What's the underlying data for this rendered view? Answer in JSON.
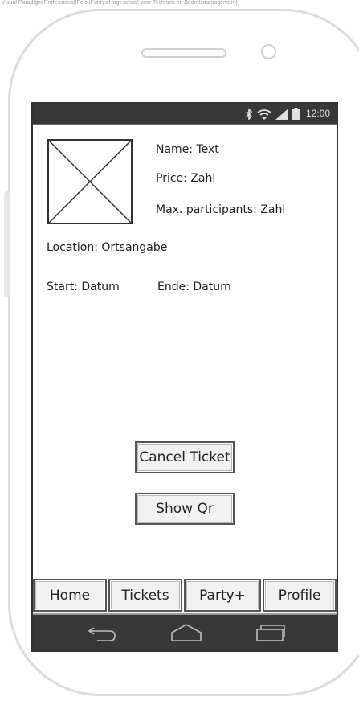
{
  "watermark": "Visual Paradigm Professional(Felix(Fontys Hogeschool voor Techniek en Bedrijfsmanagement))",
  "status_bar": {
    "time": "12:00",
    "icons": [
      "bluetooth-icon",
      "wifi-icon",
      "signal-icon",
      "battery-icon"
    ]
  },
  "details": {
    "name": "Name: Text",
    "price": "Price: Zahl",
    "max_participants": "Max. participants: Zahl",
    "location": "Location: Ortsangabe",
    "start": "Start: Datum",
    "end": "Ende: Datum"
  },
  "actions": {
    "cancel_ticket": "Cancel Ticket",
    "show_qr": "Show Qr"
  },
  "tabs": [
    {
      "label": "Home"
    },
    {
      "label": "Tickets"
    },
    {
      "label": "Party+"
    },
    {
      "label": "Profile"
    }
  ],
  "nav_bar": {
    "buttons": [
      "back-icon",
      "home-icon",
      "recent-apps-icon"
    ]
  },
  "colors": {
    "status_bar_bg": "#383838",
    "button_bg": "#f1f1f1",
    "frame": "#dcdcdc"
  }
}
